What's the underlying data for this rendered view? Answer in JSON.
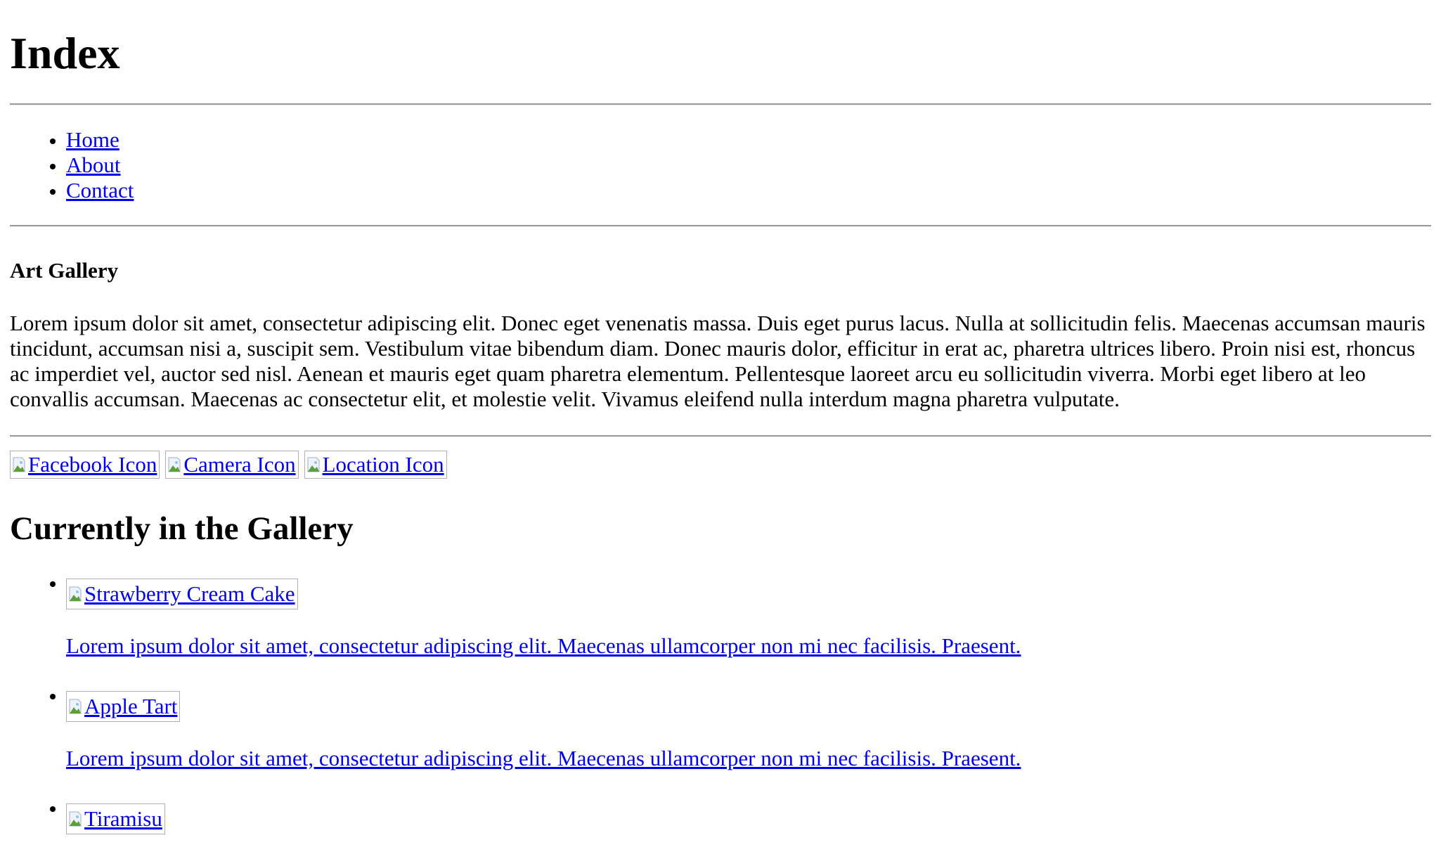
{
  "page_title": "Index",
  "nav": [
    {
      "label": "Home"
    },
    {
      "label": "About"
    },
    {
      "label": "Contact"
    }
  ],
  "section_heading": "Art Gallery",
  "intro_text": "Lorem ipsum dolor sit amet, consectetur adipiscing elit. Donec eget venenatis massa. Duis eget purus lacus. Nulla at sollicitudin felis. Maecenas accumsan mauris tincidunt, accumsan nisi a, suscipit sem. Vestibulum vitae bibendum diam. Donec mauris dolor, efficitur in erat ac, pharetra ultrices libero. Proin nisi est, rhoncus ac imperdiet vel, auctor sed nisl. Aenean et mauris eget quam pharetra elementum. Pellentesque laoreet arcu eu sollicitudin viverra. Morbi eget libero at leo convallis accumsan. Maecenas ac consectetur elit, et molestie velit. Vivamus eleifend nulla interdum magna pharetra vulputate.",
  "social_icons": [
    {
      "alt": "Facebook Icon",
      "icon": "broken-image-icon"
    },
    {
      "alt": "Camera Icon",
      "icon": "broken-image-icon"
    },
    {
      "alt": "Location Icon",
      "icon": "broken-image-icon"
    }
  ],
  "gallery_heading": "Currently in the Gallery",
  "gallery_items": [
    {
      "alt": "Strawberry Cream Cake",
      "description": "Lorem ipsum dolor sit amet, consectetur adipiscing elit. Maecenas ullamcorper non mi nec facilisis. Praesent."
    },
    {
      "alt": "Apple Tart",
      "description": "Lorem ipsum dolor sit amet, consectetur adipiscing elit. Maecenas ullamcorper non mi nec facilisis. Praesent."
    },
    {
      "alt": "Tiramisu",
      "description": ""
    }
  ],
  "colors": {
    "link": "#0000ee",
    "text": "#000000",
    "rule": "#9a9a9a",
    "image_border": "#b0b0b0"
  }
}
